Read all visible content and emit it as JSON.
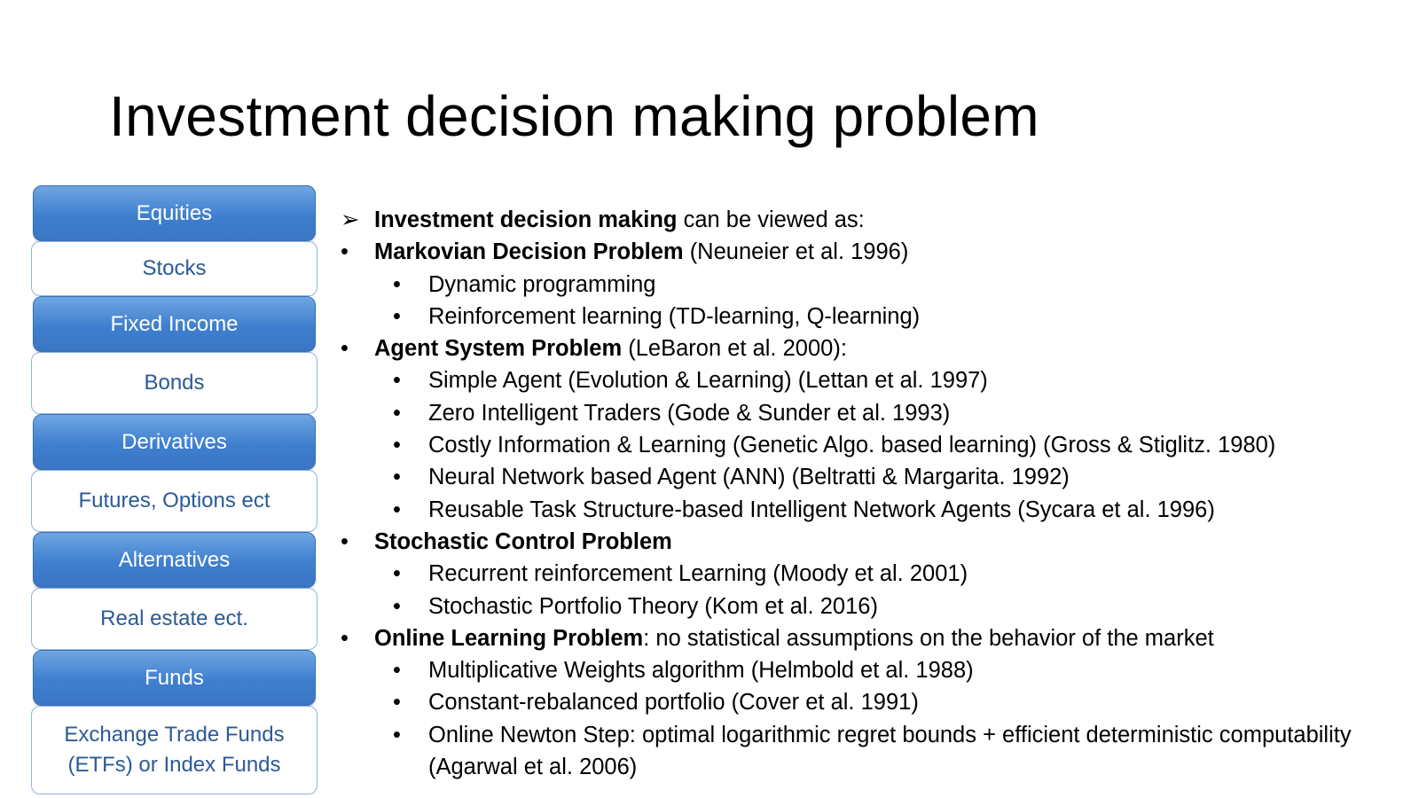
{
  "title": "Investment decision making problem",
  "asset_classes": [
    {
      "header": "Equities",
      "items": "Stocks"
    },
    {
      "header": "Fixed Income",
      "items": "Bonds"
    },
    {
      "header": "Derivatives",
      "items": "Futures, Options ect"
    },
    {
      "header": "Alternatives",
      "items": "Real estate ect."
    },
    {
      "header": "Funds",
      "items_line1": "Exchange Trade Funds",
      "items_line2": "(ETFs) or Index Funds"
    }
  ],
  "content": {
    "intro_bold": "Investment decision making",
    "intro_rest": " can be viewed as:",
    "arrow_glyph": "➢",
    "bullet_glyph": "•",
    "sections": [
      {
        "bold": "Markovian Decision Problem",
        "rest": " (Neuneier et al. 1996)",
        "subs": [
          "Dynamic programming",
          "Reinforcement learning (TD-learning, Q-learning)"
        ]
      },
      {
        "bold": "Agent System Problem",
        "rest": " (LeBaron et al. 2000):",
        "subs": [
          "Simple Agent (Evolution & Learning) (Lettan et al. 1997)",
          "Zero Intelligent Traders (Gode & Sunder et al. 1993)",
          "Costly Information & Learning (Genetic Algo. based learning) (Gross & Stiglitz. 1980)",
          "Neural Network based Agent (ANN) (Beltratti & Margarita. 1992)",
          "Reusable Task Structure-based Intelligent Network Agents (Sycara et al. 1996)"
        ]
      },
      {
        "bold": "Stochastic Control Problem",
        "rest": "",
        "subs": [
          "Recurrent reinforcement Learning (Moody et al. 2001)",
          "Stochastic Portfolio Theory (Kom et al. 2016)"
        ]
      },
      {
        "bold": "Online Learning Problem",
        "rest": ": no statistical assumptions on the behavior of the market",
        "subs": [
          "Multiplicative Weights algorithm (Helmbold et al. 1988)",
          "Constant-rebalanced portfolio (Cover et al. 1991)",
          "Online Newton Step: optimal logarithmic regret bounds + efficient deterministic computability (Agarwal et al. 2006)"
        ]
      }
    ]
  }
}
